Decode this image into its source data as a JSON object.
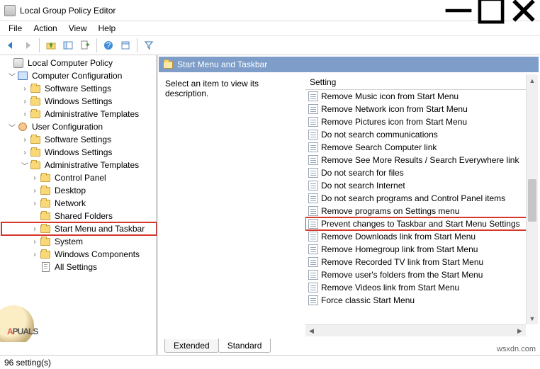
{
  "window": {
    "title": "Local Group Policy Editor"
  },
  "menu": {
    "file": "File",
    "action": "Action",
    "view": "View",
    "help": "Help"
  },
  "tree": {
    "root": "Local Computer Policy",
    "computer": "Computer Configuration",
    "c_soft": "Software Settings",
    "c_win": "Windows Settings",
    "c_admin": "Administrative Templates",
    "user": "User Configuration",
    "u_soft": "Software Settings",
    "u_win": "Windows Settings",
    "u_admin": "Administrative Templates",
    "cp": "Control Panel",
    "desktop": "Desktop",
    "network": "Network",
    "shared": "Shared Folders",
    "start": "Start Menu and Taskbar",
    "system": "System",
    "wincomp": "Windows Components",
    "allset": "All Settings"
  },
  "band": {
    "title": "Start Menu and Taskbar"
  },
  "desc": {
    "text": "Select an item to view its description."
  },
  "list": {
    "header": "Setting",
    "items": [
      "Remove Music icon from Start Menu",
      "Remove Network icon from Start Menu",
      "Remove Pictures icon from Start Menu",
      "Do not search communications",
      "Remove Search Computer link",
      "Remove See More Results / Search Everywhere link",
      "Do not search for files",
      "Do not search Internet",
      "Do not search programs and Control Panel items",
      "Remove programs on Settings menu",
      "Prevent changes to Taskbar and Start Menu Settings",
      "Remove Downloads link from Start Menu",
      "Remove Homegroup link from Start Menu",
      "Remove Recorded TV link from Start Menu",
      "Remove user's folders from the Start Menu",
      "Remove Videos link from Start Menu",
      "Force classic Start Menu"
    ]
  },
  "tabs": {
    "extended": "Extended",
    "standard": "Standard"
  },
  "status": {
    "text": "96 setting(s)"
  },
  "watermark": {
    "brand_a": "A",
    "brand_rest": "PUALS"
  },
  "origin": {
    "text": "wsxdn.com"
  }
}
